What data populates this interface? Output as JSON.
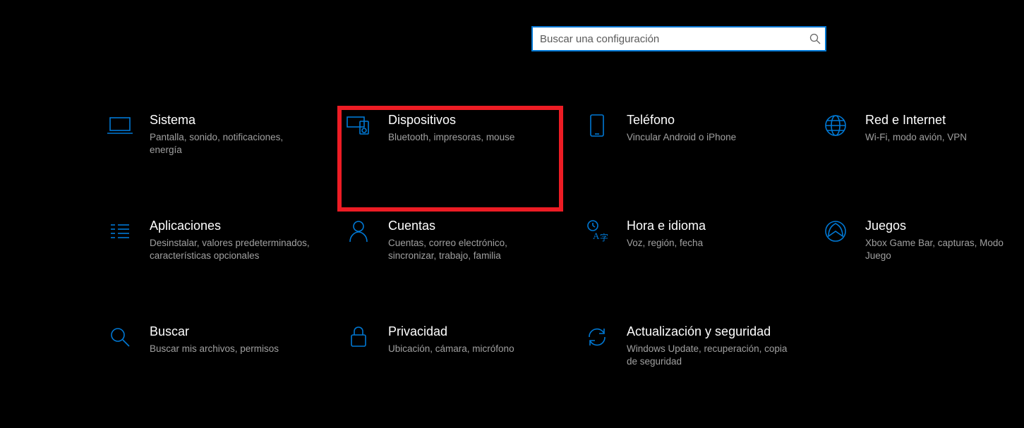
{
  "search": {
    "placeholder": "Buscar una configuración"
  },
  "tiles": {
    "system": {
      "title": "Sistema",
      "subtitle": "Pantalla, sonido, notificaciones, energía"
    },
    "devices": {
      "title": "Dispositivos",
      "subtitle": "Bluetooth, impresoras, mouse"
    },
    "phone": {
      "title": "Teléfono",
      "subtitle": "Vincular Android o iPhone"
    },
    "network": {
      "title": "Red e Internet",
      "subtitle": "Wi-Fi, modo avión, VPN"
    },
    "apps": {
      "title": "Aplicaciones",
      "subtitle": "Desinstalar, valores predeterminados, características opcionales"
    },
    "accounts": {
      "title": "Cuentas",
      "subtitle": "Cuentas, correo electrónico, sincronizar, trabajo, familia"
    },
    "time": {
      "title": "Hora e idioma",
      "subtitle": "Voz, región, fecha"
    },
    "gaming": {
      "title": "Juegos",
      "subtitle": "Xbox Game Bar, capturas, Modo Juego"
    },
    "search_cat": {
      "title": "Buscar",
      "subtitle": "Buscar mis archivos, permisos"
    },
    "privacy": {
      "title": "Privacidad",
      "subtitle": "Ubicación, cámara, micrófono"
    },
    "update": {
      "title": "Actualización y seguridad",
      "subtitle": "Windows Update, recuperación, copia de seguridad"
    }
  }
}
